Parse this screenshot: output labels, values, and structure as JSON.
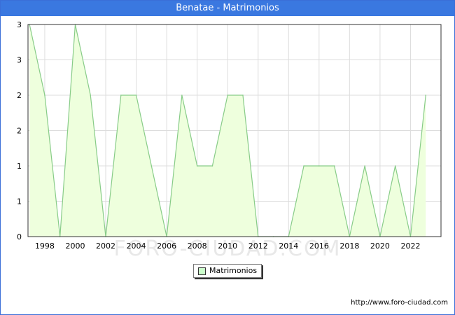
{
  "chart_data": {
    "type": "area",
    "title": "Benatae - Matrimonios",
    "x": [
      1997,
      1998,
      1999,
      2000,
      2001,
      2002,
      2003,
      2004,
      2005,
      2006,
      2007,
      2008,
      2009,
      2010,
      2011,
      2012,
      2013,
      2014,
      2015,
      2016,
      2017,
      2018,
      2019,
      2020,
      2021,
      2022,
      2023
    ],
    "series": [
      {
        "name": "Matrimonios",
        "values": [
          3,
          2,
          0,
          3,
          2,
          0,
          2,
          2,
          1,
          0,
          2,
          1,
          1,
          2,
          2,
          0,
          0,
          0,
          1,
          1,
          1,
          0,
          1,
          0,
          1,
          0,
          2
        ]
      }
    ],
    "x_ticks": [
      "1998",
      "2000",
      "2002",
      "2004",
      "2006",
      "2008",
      "2010",
      "2012",
      "2014",
      "2016",
      "2018",
      "2020",
      "2022"
    ],
    "y_tick_labels": [
      "0",
      "1",
      "1",
      "2",
      "2",
      "3",
      "3"
    ],
    "ylim": [
      0,
      3
    ],
    "xlim": [
      1996.9,
      2024
    ],
    "xlabel": "",
    "ylabel": "",
    "grid": true,
    "legend_position": "bottom-center",
    "fill_color": "#eeffdd",
    "line_color": "#88cc88"
  },
  "watermark": "FORO-CIUDAD.COM",
  "credit": "http://www.foro-ciudad.com"
}
